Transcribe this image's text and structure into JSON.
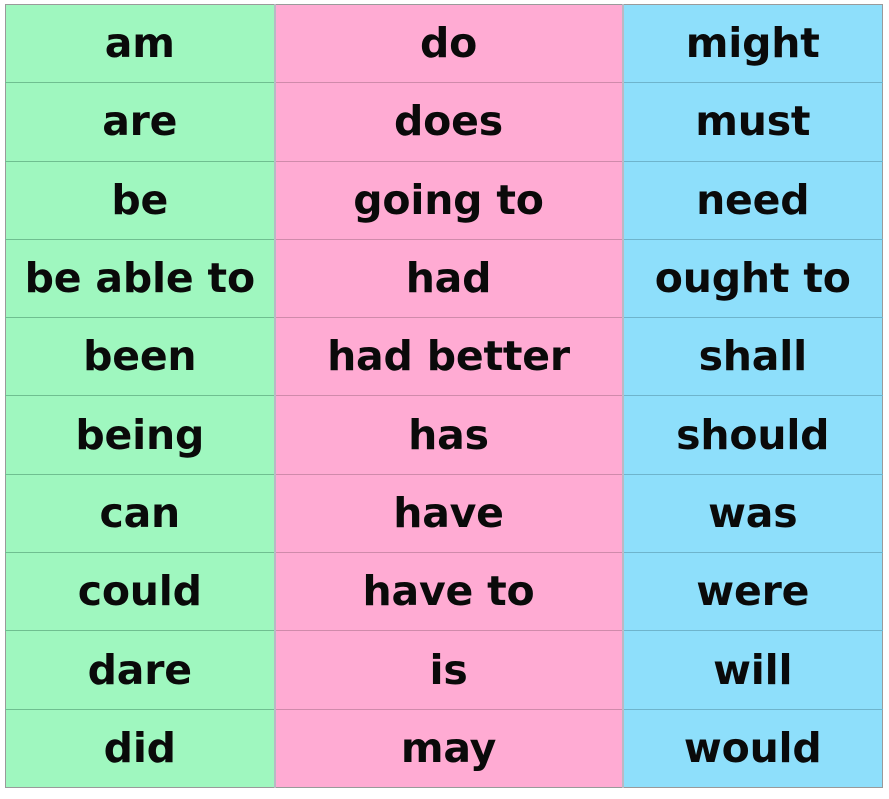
{
  "table": {
    "columns": [
      {
        "name": "column-green",
        "color": "#9ff7bf",
        "cells": [
          "am",
          "are",
          "be",
          "be able to",
          "been",
          "being",
          "can",
          "could",
          "dare",
          "did"
        ]
      },
      {
        "name": "column-pink",
        "color": "#ffabd3",
        "cells": [
          "do",
          "does",
          "going to",
          "had",
          "had better",
          "has",
          "have",
          "have to",
          "is",
          "may"
        ]
      },
      {
        "name": "column-blue",
        "color": "#8edffb",
        "cells": [
          "might",
          "must",
          "need",
          "ought to",
          "shall",
          "should",
          "was",
          "were",
          "will",
          "would"
        ]
      }
    ],
    "row_count": 10,
    "column_count": 3,
    "text_color": "#0a0a0a",
    "border_color": "#b9b9c4"
  }
}
